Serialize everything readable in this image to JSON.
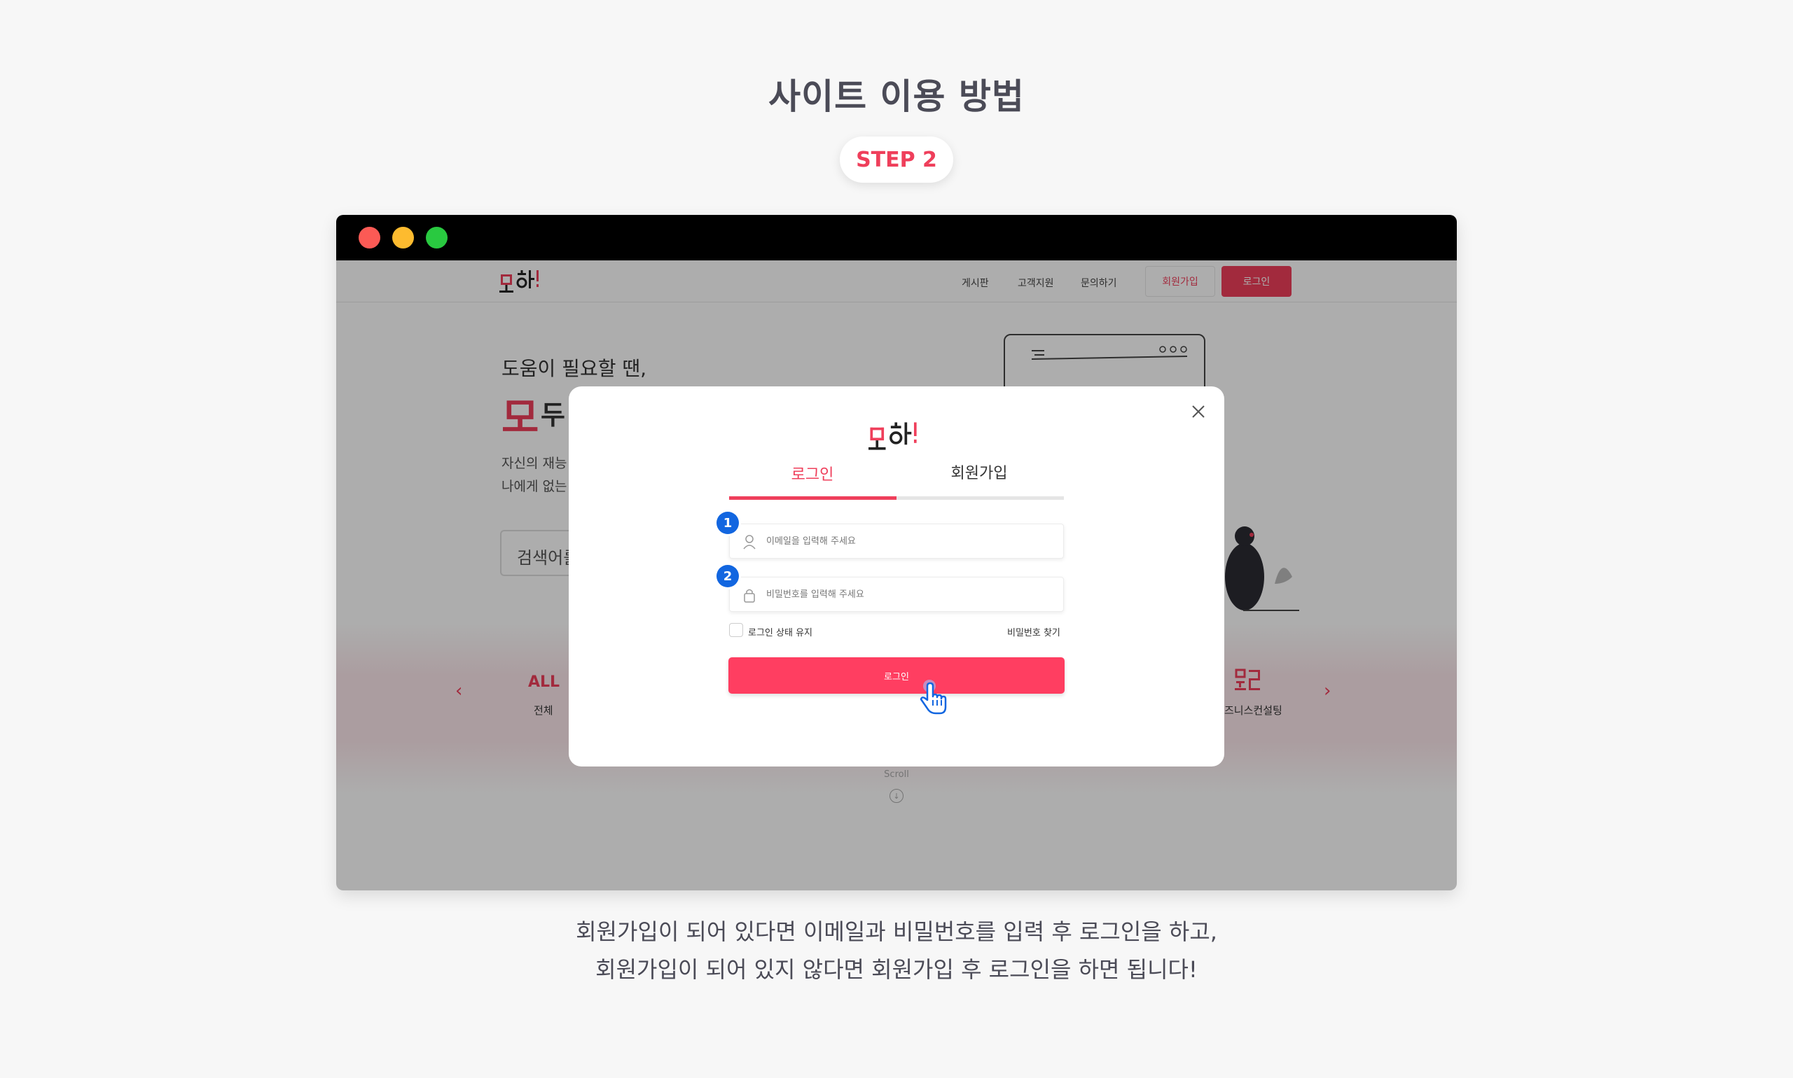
{
  "page": {
    "title": "사이트 이용 방법",
    "step": "STEP 2",
    "caption_line1": "회원가입이 되어 있다면 이메일과 비밀번호를 입력 후 로그인을 하고,",
    "caption_line2": "회원가입이 되어 있지 않다면 회원가입 후 로그인을 하면 됩니다!"
  },
  "colors": {
    "brand": "#ef3f5b",
    "badge": "#1266e0",
    "title_text": "#4b4b57"
  },
  "browser": {
    "window_buttons": [
      "close",
      "minimize",
      "maximize"
    ]
  },
  "site": {
    "logo": "모하!",
    "nav": [
      "게시판",
      "고객지원",
      "문의하기"
    ],
    "signup_button": "회원가입",
    "login_button": "로그인",
    "hero": {
      "line1": "도움이 필요할 땐,",
      "big_char": "모",
      "big_rest": "두",
      "sub1": "자신의 재능",
      "sub2": "나에게 없는"
    },
    "search_placeholder": "검색어를",
    "categories": {
      "all": "ALL",
      "all_label": "전체",
      "business_label": "즈니스컨설팅"
    },
    "scroll": "Scroll"
  },
  "modal": {
    "tabs": [
      "로그인",
      "회원가입"
    ],
    "active_tab": "로그인",
    "email_placeholder": "이메일을 입력해 주세요",
    "password_placeholder": "비밀번호를 입력해 주세요",
    "remember_label": "로그인 상태 유지",
    "find_password": "비밀번호 찾기",
    "submit": "로그인",
    "badges": [
      "1",
      "2"
    ]
  }
}
